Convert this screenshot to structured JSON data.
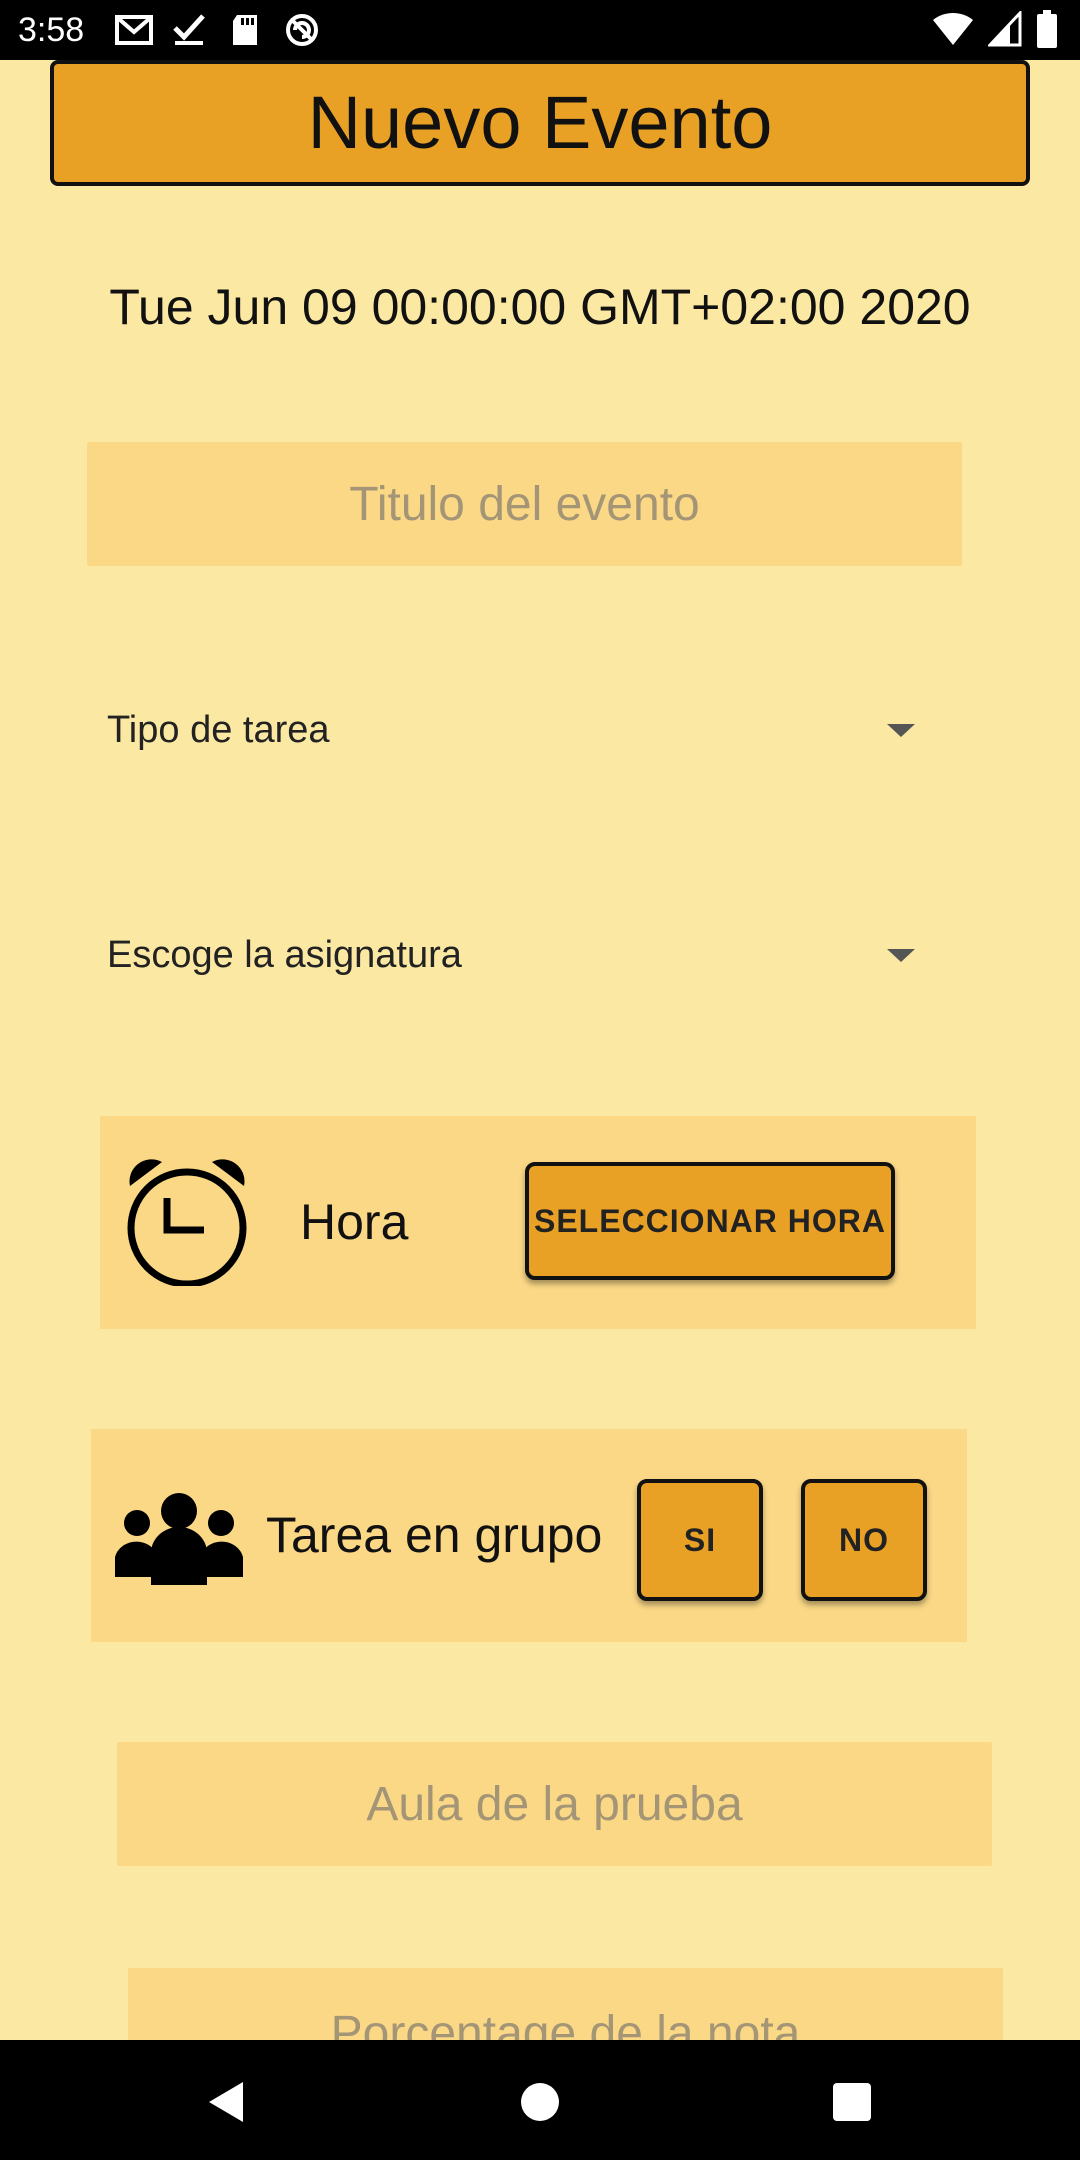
{
  "status_bar": {
    "time": "3:58",
    "left_icons": [
      "gmail-icon",
      "checkmark-icon",
      "sd-card-icon",
      "blocked-circle-icon"
    ],
    "right_icons": [
      "wifi-icon",
      "cell-signal-icon",
      "battery-icon"
    ]
  },
  "header": {
    "title": "Nuevo Evento"
  },
  "date": {
    "text": "Tue Jun 09 00:00:00 GMT+02:00 2020"
  },
  "title_input": {
    "placeholder": "Titulo del evento"
  },
  "task_type_dropdown": {
    "label": "Tipo de tarea"
  },
  "subject_dropdown": {
    "label": "Escoge la asignatura"
  },
  "hour_section": {
    "label": "Hora",
    "button_label": "SELECCIONAR HORA",
    "icon": "alarm-clock-icon"
  },
  "group_section": {
    "label": "Tarea en grupo",
    "yes_label": "SI",
    "no_label": "NO",
    "icon": "group-icon"
  },
  "classroom_input": {
    "placeholder": "Aula de la prueba"
  },
  "percentage_input": {
    "placeholder": "Porcentage de la nota"
  },
  "nav_bar": {
    "icons": [
      "back-icon",
      "home-icon",
      "recents-icon"
    ]
  },
  "colors": {
    "background": "#fbe8a2",
    "accent": "#e8a125",
    "field": "#fbd886"
  }
}
